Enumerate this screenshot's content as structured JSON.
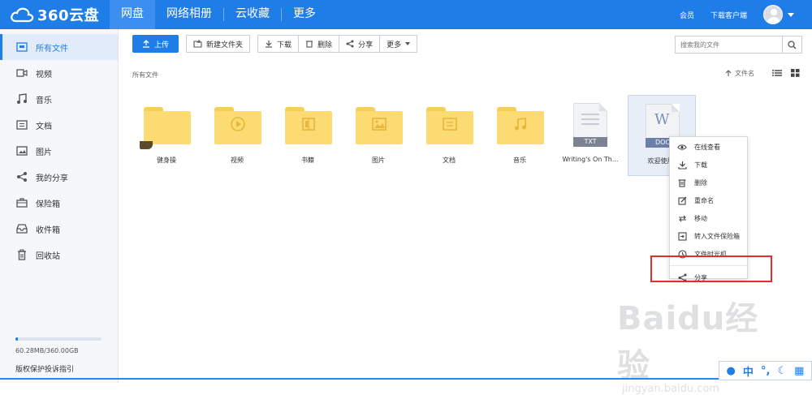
{
  "app": {
    "logo_text": "360云盘"
  },
  "nav": {
    "tabs": [
      {
        "label": "网盘",
        "active": true
      },
      {
        "label": "网络相册"
      },
      {
        "label": "云收藏"
      },
      {
        "label": "更多"
      }
    ],
    "vip": "会员",
    "download_client": "下载客户端"
  },
  "sidebar": {
    "items": [
      {
        "label": "所有文件",
        "icon": "all-files-icon",
        "active": true
      },
      {
        "label": "视频",
        "icon": "video-icon"
      },
      {
        "label": "音乐",
        "icon": "music-icon"
      },
      {
        "label": "文档",
        "icon": "document-icon"
      },
      {
        "label": "图片",
        "icon": "image-icon"
      },
      {
        "label": "我的分享",
        "icon": "share-icon"
      },
      {
        "label": "保险箱",
        "icon": "safe-icon"
      },
      {
        "label": "收件箱",
        "icon": "inbox-icon"
      },
      {
        "label": "回收站",
        "icon": "trash-icon"
      }
    ],
    "storage": {
      "used_fraction": 0.0002,
      "text": "60.28MB/360.00GB"
    },
    "report_link": "版权保护投诉指引"
  },
  "toolbar": {
    "upload": "上传",
    "new_folder": "新建文件夹",
    "download": "下载",
    "delete": "删除",
    "share": "分享",
    "more": "更多"
  },
  "search": {
    "placeholder": "搜索我的文件"
  },
  "breadcrumb": "所有文件",
  "sort": {
    "label": "文件名"
  },
  "files": [
    {
      "name": "健身操",
      "type": "folder",
      "inner_icon": "none"
    },
    {
      "name": "视频",
      "type": "folder",
      "inner_icon": "play-icon"
    },
    {
      "name": "书籍",
      "type": "folder",
      "inner_icon": "book-icon"
    },
    {
      "name": "图片",
      "type": "folder",
      "inner_icon": "picture-icon"
    },
    {
      "name": "文档",
      "type": "folder",
      "inner_icon": "doc-icon"
    },
    {
      "name": "音乐",
      "type": "folder",
      "inner_icon": "music-note-icon"
    },
    {
      "name": "Writing's On Th...",
      "type": "txt",
      "badge": "TXT"
    },
    {
      "name": "欢迎使用3",
      "type": "doc",
      "badge": "DOC",
      "letter": "W",
      "selected": true
    }
  ],
  "context_menu": {
    "items": [
      {
        "label": "在线查看",
        "icon": "eye-icon"
      },
      {
        "label": "下载",
        "icon": "download-icon"
      },
      {
        "label": "删除",
        "icon": "trash-icon"
      },
      {
        "label": "重命名",
        "icon": "rename-icon"
      },
      {
        "label": "移动",
        "icon": "move-icon"
      },
      {
        "label": "转入文件保险箱",
        "icon": "safe-transfer-icon"
      },
      {
        "label": "文件时光机",
        "icon": "clock-icon"
      },
      {
        "label": "分享",
        "icon": "share-icon",
        "highlighted": true
      }
    ]
  },
  "watermark": {
    "brand": "Baidu经验",
    "url": "jingyan.baidu.com"
  },
  "ime": {
    "lang": "中"
  },
  "colors": {
    "brand_blue": "#1f7de8",
    "highlight_red": "#e02d2d",
    "folder_yellow": "#fbdb72"
  }
}
